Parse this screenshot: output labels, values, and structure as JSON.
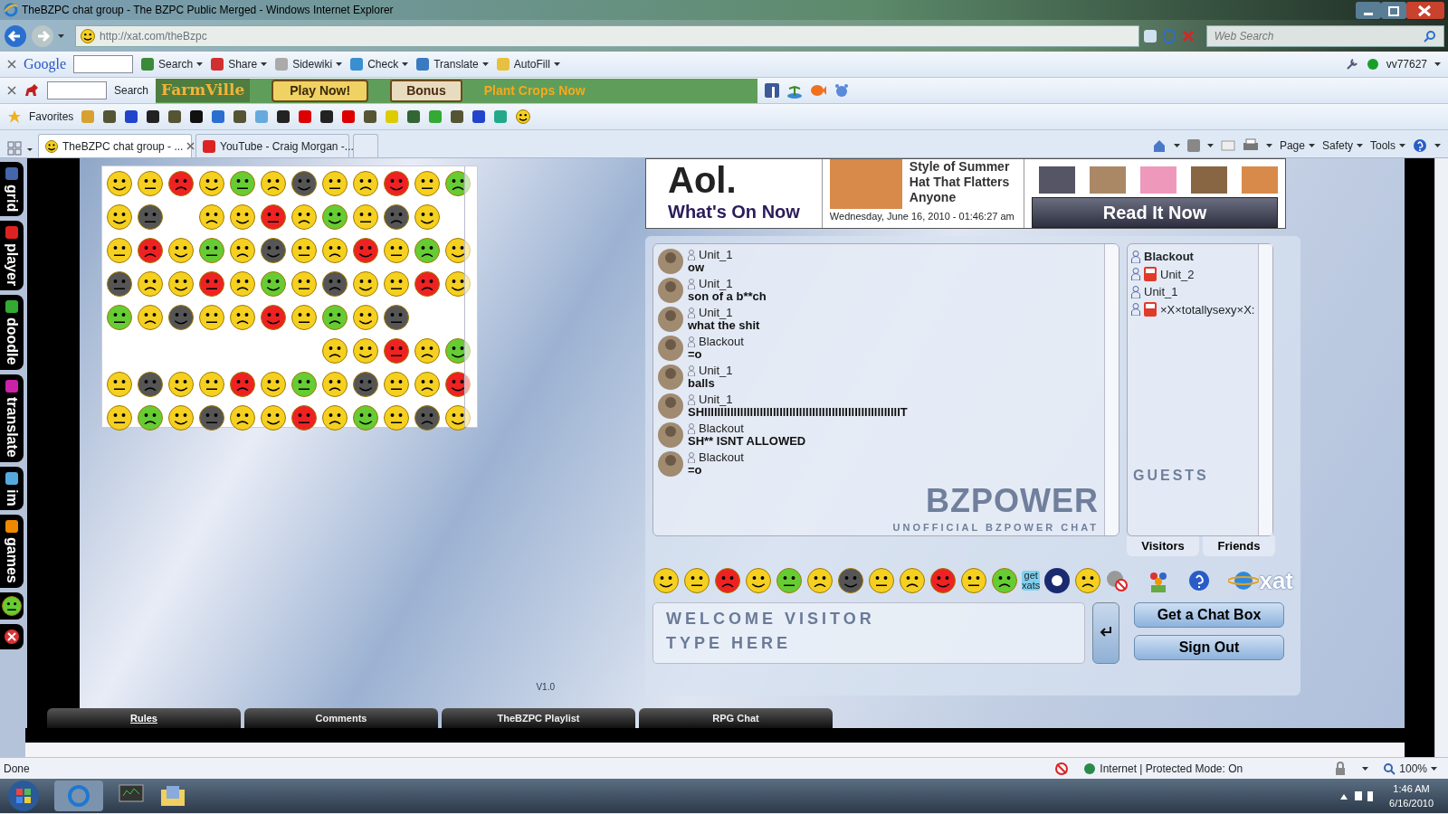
{
  "window": {
    "title": "TheBZPC chat group - The BZPC Public Merged - Windows Internet Explorer"
  },
  "address_bar": {
    "url": "http://xat.com/theBzpc",
    "search_placeholder": "Web Search"
  },
  "google_toolbar": {
    "brand": "Google",
    "items": [
      {
        "label": "Search"
      },
      {
        "label": "Share"
      },
      {
        "label": "Sidewiki"
      },
      {
        "label": "Check"
      },
      {
        "label": "Translate"
      },
      {
        "label": "AutoFill"
      }
    ],
    "account": "vv77627"
  },
  "game_toolbar": {
    "search": "Search",
    "logo": "FarmVille",
    "buttons": [
      "Play Now!",
      "Bonus"
    ],
    "link": "Plant Crops Now"
  },
  "favorites": {
    "label": "Favorites"
  },
  "tabs": [
    {
      "label": "TheBZPC chat group - ...",
      "selected": true
    },
    {
      "label": "YouTube - Craig Morgan -...",
      "selected": false
    }
  ],
  "command_bar": [
    "Page",
    "Safety",
    "Tools"
  ],
  "side_tabs": [
    "grid",
    "player",
    "doodle",
    "translate",
    "im",
    "games"
  ],
  "version": "V1.0",
  "ad": {
    "brand": "Aol.",
    "tagline": "What's On Now",
    "headline_1": "Style of Summer",
    "headline_2": "Hat That Flatters Anyone",
    "date": "Wednesday, June 16, 2010 - 01:46:27 am",
    "cta": "Read It Now"
  },
  "chat": {
    "messages": [
      {
        "user": "Unit_1",
        "text": "ow"
      },
      {
        "user": "Unit_1",
        "text": "son of a b**ch"
      },
      {
        "user": "Unit_1",
        "text": "what the shit"
      },
      {
        "user": "Blackout",
        "text": "=o"
      },
      {
        "user": "Unit_1",
        "text": "balls"
      },
      {
        "user": "Unit_1",
        "text": "SHIIIIIIIIIIIIIIIIIIIIIIIIIIIIIIIIIIIIIIIIIIIIIIIIIIIIIIIIIIIIT"
      },
      {
        "user": "Blackout",
        "text": "SH** ISNT ALLOWED"
      },
      {
        "user": "Blackout",
        "text": "=o"
      }
    ],
    "users": [
      {
        "name": "Blackout",
        "self": true,
        "badge": false
      },
      {
        "name": "Unit_2",
        "self": false,
        "badge": true
      },
      {
        "name": "Unit_1",
        "self": false,
        "badge": false
      },
      {
        "name": "×X×totallysexy×X:",
        "self": false,
        "badge": true
      }
    ],
    "watermark": {
      "label": "GUESTS",
      "logo": "BZPOWER",
      "subtitle": "UNOFFICIAL BZPOWER CHAT"
    },
    "list_tabs": [
      "Visitors",
      "Friends"
    ],
    "get_xats": "get xats",
    "xat_logo": "xat",
    "placeholder": "WELCOME VISITOR\nTYPE HERE",
    "buttons": [
      "Get a Chat Box",
      "Sign Out"
    ]
  },
  "bottom_tabs": [
    {
      "label": "Rules",
      "selected": true
    },
    {
      "label": "Comments",
      "selected": false
    },
    {
      "label": "TheBZPC Playlist",
      "selected": false
    },
    {
      "label": "RPG Chat",
      "selected": false
    }
  ],
  "status_bar": {
    "text": "Done",
    "zone": "Internet | Protected Mode: On",
    "zoom": "100%"
  },
  "taskbar": {
    "time": "1:46 AM",
    "date": "6/16/2010"
  }
}
